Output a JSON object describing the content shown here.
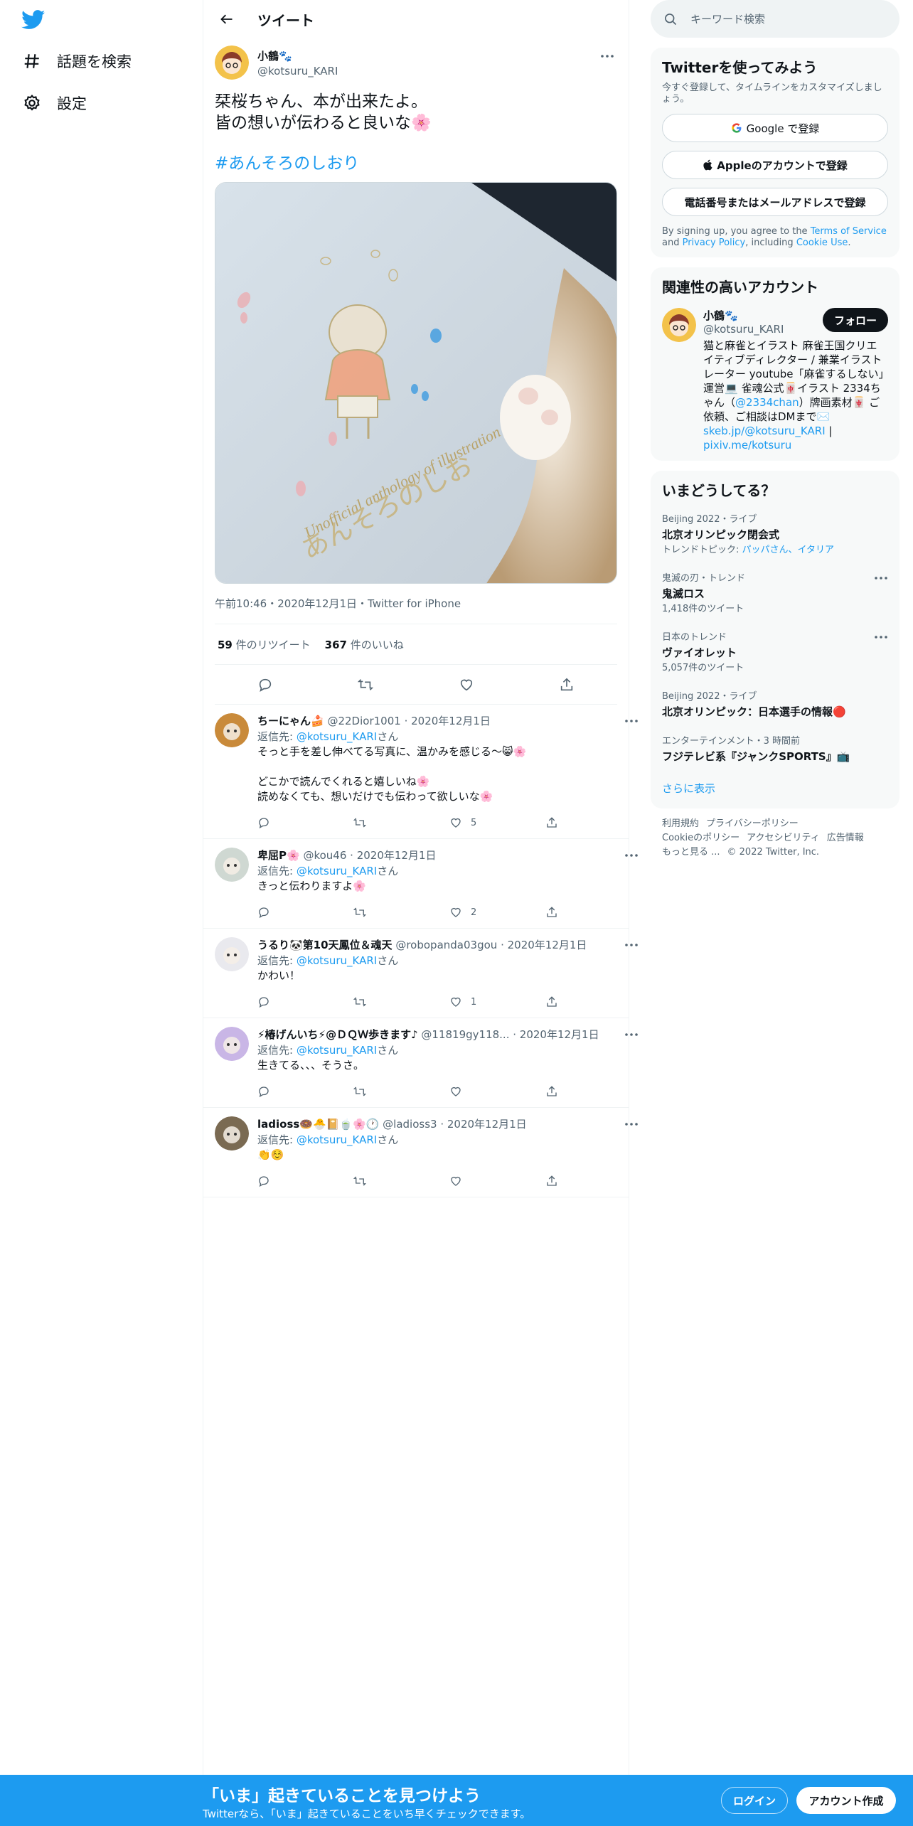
{
  "nav": {
    "explore": "話題を検索",
    "settings": "設定"
  },
  "header": {
    "title": "ツイート"
  },
  "tweet": {
    "author_name": "小鶴🐾",
    "author_handle": "@kotsuru_KARI",
    "text_line1": "栞桜ちゃん、本が出来たよ。",
    "text_line2": "皆の想いが伝わると良いな🌸",
    "hashtag": "#あんそろのしおり",
    "image_caption": "Unofficial anthology of illustration",
    "image_title": "あんそろのしお",
    "meta": "午前10:46・2020年12月1日・Twitter for iPhone",
    "retweets": "59",
    "retweets_label": " 件のリツイート",
    "likes": "367",
    "likes_label": " 件のいいね"
  },
  "replies": [
    {
      "name": "ちーにゃん🍰",
      "handle": "@22Dior1001",
      "date": "2020年12月1日",
      "reply_prefix": "返信先: ",
      "reply_to": "@kotsuru_KARI",
      "reply_suffix": "さん",
      "text": "そっと手を差し伸べてる写真に、温かみを感じる～😸🌸\n\nどこかで読んでくれると嬉しいね🌸\n読めなくても、想いだけでも伝わって欲しいな🌸",
      "like_count": "5"
    },
    {
      "name": "卑屈P🌸",
      "handle": "@kou46",
      "date": "2020年12月1日",
      "reply_prefix": "返信先: ",
      "reply_to": "@kotsuru_KARI",
      "reply_suffix": "さん",
      "text": "きっと伝わりますよ🌸",
      "like_count": "2"
    },
    {
      "name": "うるり🐼第10天鳳位＆魂天",
      "handle": "@robopanda03gou",
      "date": "2020年12月1日",
      "reply_prefix": "返信先: ",
      "reply_to": "@kotsuru_KARI",
      "reply_suffix": "さん",
      "text": "かわい！",
      "like_count": "1"
    },
    {
      "name": "⚡椿げんいち⚡@ＤＱＷ歩きます♪",
      "handle": "@11819gy118...",
      "date": "2020年12月1日",
      "reply_prefix": "返信先: ",
      "reply_to": "@kotsuru_KARI",
      "reply_suffix": "さん",
      "text": "生きてる、、、そうさ。",
      "like_count": ""
    },
    {
      "name": "ladioss🍩🐣📔🍵🌸🕐",
      "handle": "@ladioss3",
      "date": "2020年12月1日",
      "reply_prefix": "返信先: ",
      "reply_to": "@kotsuru_KARI",
      "reply_suffix": "さん",
      "text": "👏☺️",
      "like_count": ""
    }
  ],
  "search": {
    "placeholder": "キーワード検索"
  },
  "signup_card": {
    "title": "Twitterを使ってみよう",
    "subtitle": "今すぐ登録して、タイムラインをカスタマイズしましょう。",
    "google": "Google で登録",
    "apple": "Appleのアカウントで登録",
    "phone": "電話番号またはメールアドレスで登録",
    "legal_prefix": "By signing up, you agree to the ",
    "terms": "Terms of Service",
    "legal_and": " and ",
    "privacy": "Privacy Policy",
    "legal_including": ", including ",
    "cookie": "Cookie Use",
    "legal_end": "."
  },
  "related": {
    "title": "関連性の高いアカウント",
    "name": "小鶴🐾",
    "handle": "@kotsuru_KARI",
    "follow": "フォロー",
    "bio_part1": "猫と麻雀とイラスト 麻雀王国クリエイティブディレクター / 兼業イラストレーター youtube「麻雀するしない」運営💻 雀魂公式🀄イラスト 2334ちゃん（",
    "bio_link1": "@2334chan",
    "bio_part2": "）牌画素材🀄 ご依頼、ご相談はDMまで✉️",
    "bio_link2": "skeb.jp/@kotsuru_KARI",
    "bio_sep": " | ",
    "bio_link3": "pixiv.me/kotsuru"
  },
  "trends": {
    "title": "いまどうしてる？",
    "items": [
      {
        "category": "Beijing 2022・ライブ",
        "title": "北京オリンピック閉会式",
        "sub_prefix": "トレンドトピック: ",
        "sub_links": "パッパさん、イタリア",
        "has_more": false
      },
      {
        "category": "鬼滅の刃・トレンド",
        "title": "鬼滅ロス",
        "sub_prefix": "1,418件のツイート",
        "sub_links": "",
        "has_more": true
      },
      {
        "category": "日本のトレンド",
        "title": "ヴァイオレット",
        "sub_prefix": "5,057件のツイート",
        "sub_links": "",
        "has_more": true
      },
      {
        "category": "Beijing 2022・ライブ",
        "title": "北京オリンピック：日本選手の情報🔴",
        "sub_prefix": "",
        "sub_links": "",
        "has_more": false
      },
      {
        "category": "エンターテインメント・3 時間前",
        "title": "フジテレビ系『ジャンクSPORTS』📺",
        "sub_prefix": "",
        "sub_links": "",
        "has_more": false
      }
    ],
    "show_more": "さらに表示"
  },
  "footer": {
    "terms": "利用規約",
    "privacy": "プライバシーポリシー",
    "cookie": "Cookieのポリシー",
    "accessibility": "アクセシビリティ",
    "ads": "広告情報",
    "more": "もっと見る ...",
    "copyright": "© 2022 Twitter, Inc."
  },
  "bottom": {
    "title": "「いま」起きていることを見つけよう",
    "subtitle": "Twitterなら、「いま」起きていることをいち早くチェックできます。",
    "login": "ログイン",
    "signup": "アカウント作成"
  },
  "colors": {
    "accent": "#1d9bf0",
    "text": "#0f1419",
    "muted": "#536471"
  }
}
